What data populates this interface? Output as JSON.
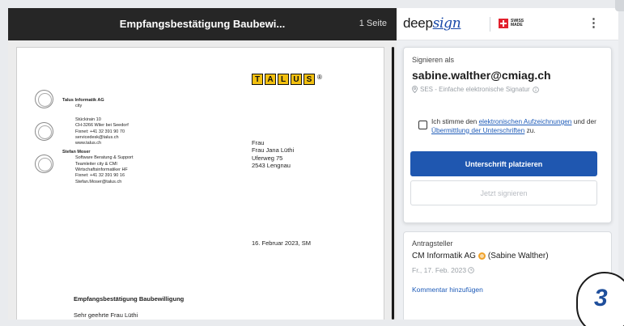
{
  "viewer": {
    "title": "Empfangsbestätigung Baubewi...",
    "page_count": "1 Seite"
  },
  "letter": {
    "logo_letters": [
      "T",
      "A",
      "L",
      "U",
      "S"
    ],
    "logo_mark": "®",
    "company": "Talus Informatik AG",
    "company_sub": "city",
    "address_lines": [
      "Stückirain 10",
      "CH-3266 Wiler bei Seedorf",
      "Fixnet:   +41 32 391 90 70",
      "servicedesk@talus.ch",
      "www.talus.ch"
    ],
    "contact_name": "Stefan Moser",
    "contact_lines": [
      "Software Beratung & Support",
      "Teamleiter city & CMI",
      "Wirtschaftsinformatiker HF",
      "Fixnet:   +41 32 391 90 16",
      "Stefan.Moser@talus.ch"
    ],
    "recipient_lines": [
      "Frau",
      "Frau Jana Lüthi",
      "Uferweg 75",
      "2543 Lengnau"
    ],
    "date_line": "16. Februar 2023, SM",
    "subject": "Empfangsbestätigung Baubewilligung",
    "salutation": "Sehr geehrte Frau Lüthi"
  },
  "panel": {
    "brand_prefix": "deep",
    "brand_suffix": "sign",
    "swiss_label_1": "SWISS",
    "swiss_label_2": "MADE",
    "menu_icon": "⋮",
    "sign_as_label": "Signieren als",
    "email": "sabine.walther@cmiag.ch",
    "signature_type": "SES - Einfache elektronische Signatur",
    "consent_pre": "Ich stimme den ",
    "consent_link1": "elektronischen Aufzeichnungen",
    "consent_mid": " und der ",
    "consent_link2": "Übermittlung der Unterschriften",
    "consent_post": " zu.",
    "place_signature_button": "Unterschrift platzieren",
    "sign_now_button": "Jetzt signieren",
    "requester_label": "Antragsteller",
    "requester_org": "CM Informatik AG",
    "requester_person": "(Sabine Walther)",
    "requester_date": "Fr., 17. Feb. 2023",
    "add_comment": "Kommentar hinzufügen"
  },
  "step_badge": "3",
  "colors": {
    "primary_button": "#1f57b0",
    "link": "#1e5bb8",
    "logo_yellow": "#f2c010",
    "viewer_bar": "#262626",
    "verified_badge": "#f0a22a"
  },
  "icons": {
    "location": "map-pin-icon",
    "info": "info-icon",
    "clock": "clock-icon",
    "verified": "verified-badge-icon"
  }
}
